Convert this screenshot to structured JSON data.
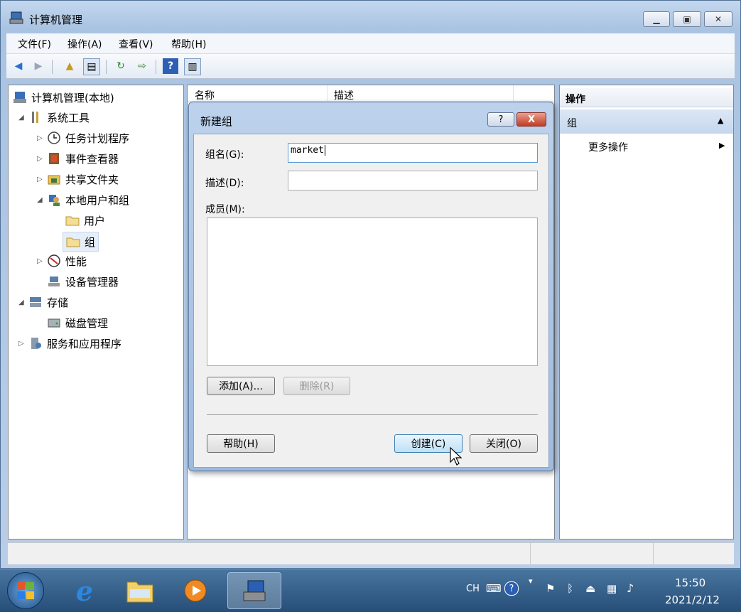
{
  "window": {
    "title": "计算机管理"
  },
  "menu": [
    "文件(F)",
    "操作(A)",
    "查看(V)",
    "帮助(H)"
  ],
  "tree": [
    {
      "label": "计算机管理(本地)",
      "expander": "",
      "icon": "computer-management-icon"
    },
    {
      "label": "系统工具",
      "expander": "◢",
      "icon": "tools-icon"
    },
    {
      "label": "任务计划程序",
      "expander": "▷",
      "icon": "clock-icon"
    },
    {
      "label": "事件查看器",
      "expander": "▷",
      "icon": "event-viewer-icon"
    },
    {
      "label": "共享文件夹",
      "expander": "▷",
      "icon": "shared-folder-icon"
    },
    {
      "label": "本地用户和组",
      "expander": "◢",
      "icon": "users-icon"
    },
    {
      "label": "用户",
      "expander": "",
      "icon": "folder-icon"
    },
    {
      "label": "组",
      "expander": "",
      "icon": "folder-icon"
    },
    {
      "label": "性能",
      "expander": "▷",
      "icon": "performance-icon"
    },
    {
      "label": "设备管理器",
      "expander": "",
      "icon": "device-manager-icon"
    },
    {
      "label": "存储",
      "expander": "◢",
      "icon": "storage-icon"
    },
    {
      "label": "磁盘管理",
      "expander": "",
      "icon": "disk-icon"
    },
    {
      "label": "服务和应用程序",
      "expander": "▷",
      "icon": "services-icon"
    }
  ],
  "list": {
    "col_name": "名称",
    "col_desc": "描述"
  },
  "actions": {
    "header": "操作",
    "section": "组",
    "more": "更多操作"
  },
  "dialog": {
    "title": "新建组",
    "help_glyph": "?",
    "close_glyph": "X",
    "name_label": "组名(G):",
    "name_value": "market",
    "desc_label": "描述(D):",
    "desc_value": "",
    "members_label": "成员(M):",
    "add_button": "添加(A)...",
    "remove_button": "删除(R)",
    "help_button": "帮助(H)",
    "create_button": "创建(C)",
    "close_button": "关闭(O)"
  },
  "tray": {
    "lang": "CH",
    "time": "15:50",
    "date": "2021/2/12"
  }
}
